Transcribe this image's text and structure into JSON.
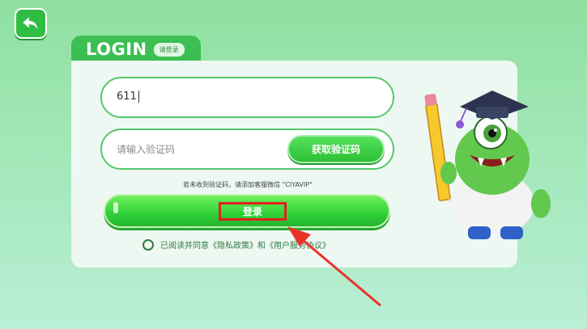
{
  "header": {
    "title": "LOGIN",
    "subtitle": "请登录"
  },
  "phone": {
    "value": "611"
  },
  "code": {
    "placeholder": "请输入验证码",
    "get_code_label": "获取验证码"
  },
  "hint": "若未收到验证码，请添加客服微信 \"CIYAVIP\"",
  "login_button": "登录",
  "agreement": "已阅读并同意《隐私政策》和《用户服务协议》",
  "colors": {
    "accent": "#3cbf52",
    "button": "#2fd038",
    "highlight": "#e21f1f"
  }
}
